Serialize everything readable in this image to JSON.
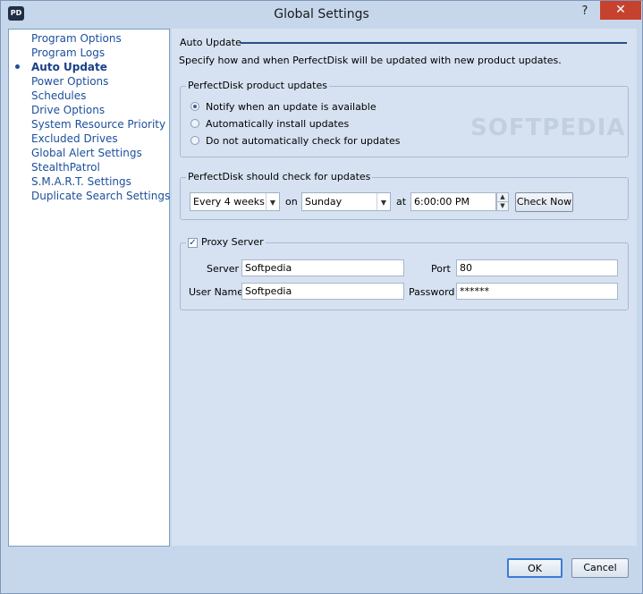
{
  "window": {
    "title": "Global Settings",
    "app_icon": "PD",
    "help_glyph": "?",
    "close_glyph": "✕"
  },
  "sidebar": {
    "items": [
      {
        "label": "Program Options"
      },
      {
        "label": "Program Logs"
      },
      {
        "label": "Auto Update",
        "active": true
      },
      {
        "label": "Power Options"
      },
      {
        "label": "Schedules"
      },
      {
        "label": "Drive Options"
      },
      {
        "label": "System Resource Priority"
      },
      {
        "label": "Excluded Drives"
      },
      {
        "label": "Global Alert Settings"
      },
      {
        "label": "StealthPatrol"
      },
      {
        "label": "S.M.A.R.T. Settings"
      },
      {
        "label": "Duplicate Search Settings"
      }
    ]
  },
  "main": {
    "section_title": "Auto Update",
    "description": "Specify how and when PerfectDisk will be updated with new product updates.",
    "product_updates": {
      "title": "PerfectDisk product updates",
      "options": [
        {
          "label": "Notify when an update is available",
          "checked": true
        },
        {
          "label": "Automatically install updates",
          "checked": false
        },
        {
          "label": "Do not automatically check for updates",
          "checked": false
        }
      ]
    },
    "check_schedule": {
      "title": "PerfectDisk should check for updates",
      "frequency": "Every 4 weeks",
      "on_label": "on",
      "day": "Sunday",
      "at_label": "at",
      "time": "6:00:00 PM",
      "check_now_label": "Check Now"
    },
    "proxy": {
      "enabled": true,
      "title": "Proxy Server",
      "server_label": "Server",
      "server_value": "Softpedia",
      "port_label": "Port",
      "port_value": "80",
      "username_label": "User Name",
      "username_value": "Softpedia",
      "password_label": "Password",
      "password_value": "******"
    }
  },
  "footer": {
    "ok_label": "OK",
    "cancel_label": "Cancel"
  },
  "watermark": "SOFTPEDIA",
  "colors": {
    "accent": "#1c4f9c",
    "close": "#c7412f",
    "panel": "#d6e2f1"
  }
}
